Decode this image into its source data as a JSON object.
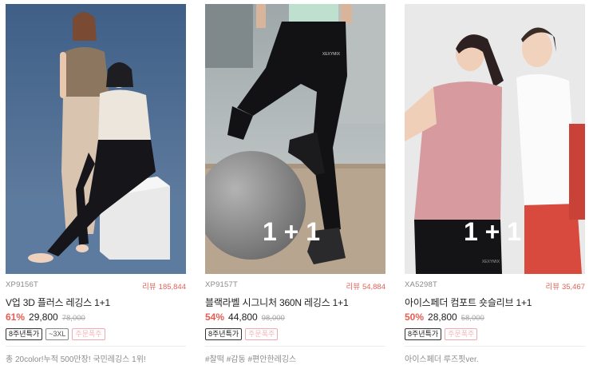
{
  "products": [
    {
      "code": "XP9156T",
      "review_label": "리뷰",
      "review_count": "185,844",
      "name": "V업 3D 플러스 레깅스 1+1",
      "discount": "61%",
      "price": "29,800",
      "original_price": "78,000",
      "badges": [
        "8주년특가",
        "~3XL",
        "주문폭주"
      ],
      "tagline": "총 20color!누적 500만장! 국민레깅스 1위!",
      "image_icon": "two-models-leggings-photo"
    },
    {
      "code": "XP9157T",
      "review_label": "리뷰",
      "review_count": "54,884",
      "name": "블랙라벨 시그니처 360N 레깅스 1+1",
      "discount": "54%",
      "price": "44,800",
      "original_price": "98,000",
      "badges": [
        "8주년특가",
        "주문폭주"
      ],
      "tagline": "#찰떡 #감동 #편안한레깅스",
      "image_overlay": "1 + 1",
      "image_icon": "model-on-exercise-ball-photo"
    },
    {
      "code": "XA5298T",
      "review_label": "리뷰",
      "review_count": "35,467",
      "name": "아이스페더 컴포트 숏슬리브 1+1",
      "discount": "50%",
      "price": "28,800",
      "original_price": "58,000",
      "badges": [
        "8주년특가",
        "주문폭주"
      ],
      "tagline": "아이스페더 루즈핏ver.",
      "image_overlay": "1 + 1",
      "image_icon": "two-models-tshirt-photo"
    }
  ]
}
